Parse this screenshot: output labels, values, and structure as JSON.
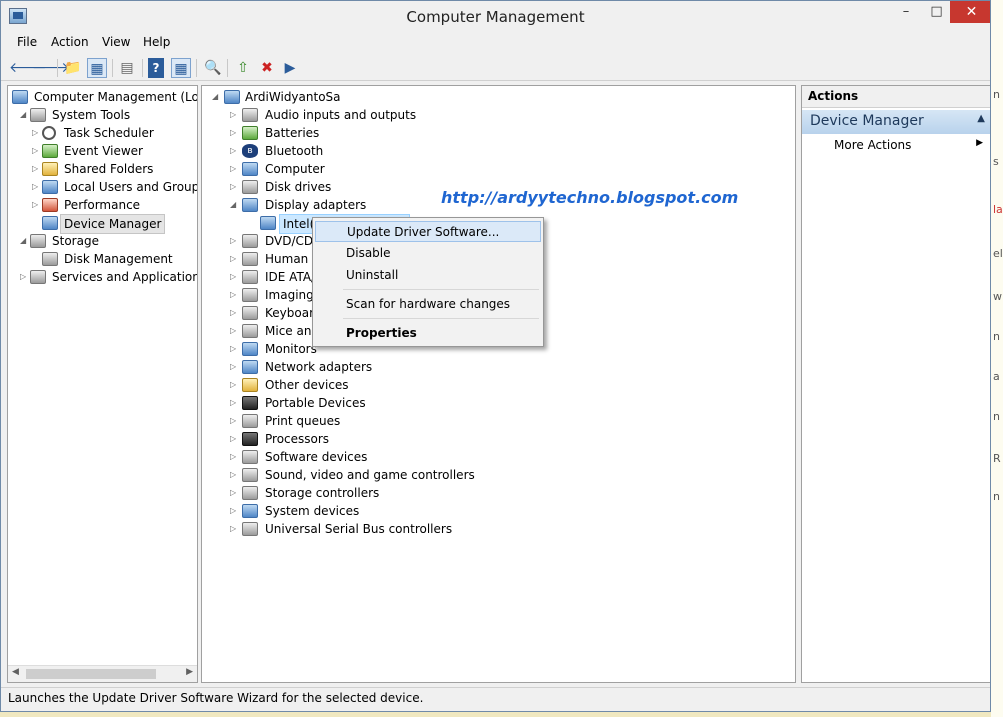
{
  "window": {
    "title": "Computer Management"
  },
  "menubar": [
    "File",
    "Action",
    "View",
    "Help"
  ],
  "left_tree": [
    {
      "label": "Computer Management (Local",
      "level": 0,
      "exp": "",
      "icon": "computer-management-icon",
      "color": "blue"
    },
    {
      "label": "System Tools",
      "level": 1,
      "exp": "◢",
      "icon": "system-tools-icon",
      "color": "gray"
    },
    {
      "label": "Task Scheduler",
      "level": 2,
      "exp": "▷",
      "icon": "clock-icon",
      "color": "clock"
    },
    {
      "label": "Event Viewer",
      "level": 2,
      "exp": "▷",
      "icon": "event-viewer-icon",
      "color": "green"
    },
    {
      "label": "Shared Folders",
      "level": 2,
      "exp": "▷",
      "icon": "shared-folders-icon",
      "color": "yellow"
    },
    {
      "label": "Local Users and Groups",
      "level": 2,
      "exp": "▷",
      "icon": "users-icon",
      "color": "blue"
    },
    {
      "label": "Performance",
      "level": 2,
      "exp": "▷",
      "icon": "performance-icon",
      "color": "red"
    },
    {
      "label": "Device Manager",
      "level": 2,
      "exp": "",
      "icon": "device-manager-icon",
      "color": "blue"
    },
    {
      "label": "Storage",
      "level": 1,
      "exp": "◢",
      "icon": "storage-icon",
      "color": "gray"
    },
    {
      "label": "Disk Management",
      "level": 2,
      "exp": "",
      "icon": "disk-management-icon",
      "color": "gray"
    },
    {
      "label": "Services and Applications",
      "level": 1,
      "exp": "▷",
      "icon": "services-icon",
      "color": "gray"
    }
  ],
  "device_tree": {
    "root": "ArdiWidyantoSa",
    "categories": [
      {
        "label": "Audio inputs and outputs",
        "icon": "speaker-icon",
        "color": "gray"
      },
      {
        "label": "Batteries",
        "icon": "battery-icon",
        "color": "green"
      },
      {
        "label": "Bluetooth",
        "icon": "bluetooth-icon",
        "color": "bt"
      },
      {
        "label": "Computer",
        "icon": "computer-icon",
        "color": "blue"
      },
      {
        "label": "Disk drives",
        "icon": "disk-drive-icon",
        "color": "gray"
      },
      {
        "label": "Display adapters",
        "icon": "display-adapter-icon",
        "color": "blue"
      },
      {
        "label": "Intel(R) HD Graphics",
        "icon": "display-adapter-icon",
        "color": "blue",
        "child": true
      },
      {
        "label": "DVD/CD-ROM drives",
        "icon": "dvd-icon",
        "color": "gray"
      },
      {
        "label": "Human Interface Devices",
        "icon": "hid-icon",
        "color": "gray"
      },
      {
        "label": "IDE ATA/ATAPI controllers",
        "icon": "ide-icon",
        "color": "gray"
      },
      {
        "label": "Imaging devices",
        "icon": "camera-icon",
        "color": "gray"
      },
      {
        "label": "Keyboards",
        "icon": "keyboard-icon",
        "color": "gray"
      },
      {
        "label": "Mice and other pointing devices",
        "icon": "mouse-icon",
        "color": "gray"
      },
      {
        "label": "Monitors",
        "icon": "monitor-icon",
        "color": "blue"
      },
      {
        "label": "Network adapters",
        "icon": "network-icon",
        "color": "blue"
      },
      {
        "label": "Other devices",
        "icon": "other-devices-icon",
        "color": "yellow"
      },
      {
        "label": "Portable Devices",
        "icon": "portable-device-icon",
        "color": "dark"
      },
      {
        "label": "Print queues",
        "icon": "printer-icon",
        "color": "gray"
      },
      {
        "label": "Processors",
        "icon": "processor-icon",
        "color": "dark"
      },
      {
        "label": "Software devices",
        "icon": "software-device-icon",
        "color": "gray"
      },
      {
        "label": "Sound, video and game controllers",
        "icon": "sound-icon",
        "color": "gray"
      },
      {
        "label": "Storage controllers",
        "icon": "storage-controller-icon",
        "color": "gray"
      },
      {
        "label": "System devices",
        "icon": "system-device-icon",
        "color": "blue"
      },
      {
        "label": "Universal Serial Bus controllers",
        "icon": "usb-icon",
        "color": "gray"
      }
    ]
  },
  "watermark": "http://ardyytechno.blogspot.com",
  "context_menu": {
    "update": "Update Driver Software...",
    "disable": "Disable",
    "uninstall": "Uninstall",
    "scan": "Scan for hardware changes",
    "properties": "Properties"
  },
  "actions": {
    "header": "Actions",
    "section": "Device Manager",
    "more": "More Actions"
  },
  "status": "Launches the Update Driver Software Wizard for the selected device."
}
